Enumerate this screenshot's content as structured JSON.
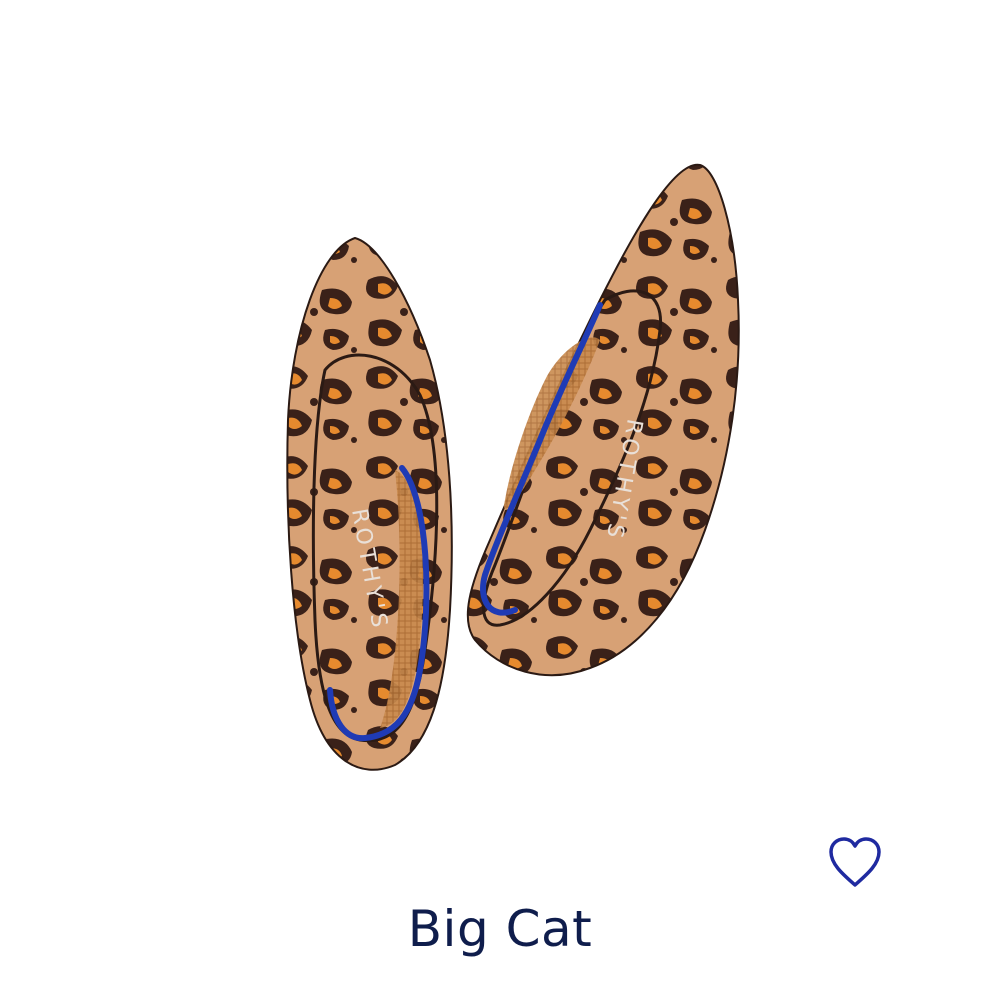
{
  "product": {
    "name": "Big Cat",
    "image_alt": "pair of pointed-toe knit flats",
    "brand_mark": "ROTHY'S"
  },
  "wishlist": {
    "icon": "heart-outline-icon",
    "color": "#1f2aa0"
  },
  "colors": {
    "title": "#0f1d4c",
    "knit_base": "#d7a175",
    "spot_dark": "#3a2119",
    "spot_orange": "#e68a2e",
    "trim_blue": "#1f3bb5",
    "insole": "#c98a4d"
  }
}
